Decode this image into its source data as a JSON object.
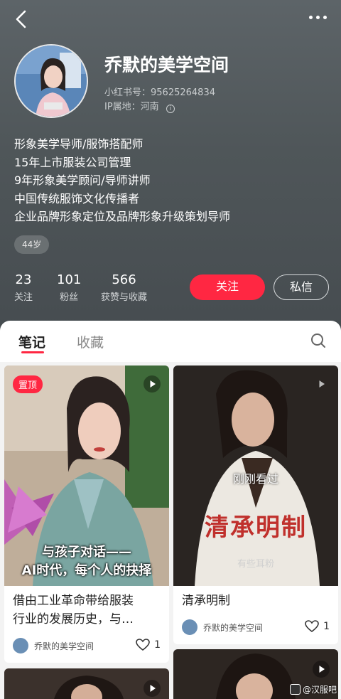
{
  "profile": {
    "nickname": "乔默的美学空间",
    "xhs_id": "小红书号：95625264834",
    "ip_location": "IP属地：河南",
    "bio": [
      "形象美学导师/服饰搭配师",
      "15年上市服装公司管理",
      "9年形象美学顾问/导师讲师",
      "中国传统服饰文化传播者",
      "企业品牌形象定位及品牌形象升级策划导师"
    ],
    "age_tag": "44岁",
    "stats": [
      {
        "num": "23",
        "label": "关注"
      },
      {
        "num": "101",
        "label": "粉丝"
      },
      {
        "num": "566",
        "label": "获赞与收藏"
      }
    ],
    "follow_label": "关注",
    "message_label": "私信"
  },
  "tabs": [
    {
      "label": "笔记",
      "active": true
    },
    {
      "label": "收藏",
      "active": false
    }
  ],
  "cards": [
    {
      "pin_label": "置顶",
      "overlay_line1": "与孩子对话——",
      "overlay_line2": "AI时代，每个人的抉择",
      "title_line1": "借由工业革命带给服装",
      "title_line2": "行业的发展历史，与…",
      "author": "乔默的美学空间",
      "likes": "1"
    },
    {
      "overlay_seen": "刚刚看过",
      "overlay_big": "清承明制",
      "overlay_small": "有些耳粉",
      "title": "清承明制",
      "author": "乔默的美学空间",
      "likes": "1"
    }
  ],
  "watermark": "@汉服吧",
  "colors": {
    "accent": "#ff2742",
    "header_bg": "#50575a"
  },
  "icons": [
    "back-icon",
    "more-icon",
    "info-icon",
    "search-icon",
    "play-icon",
    "heart-icon"
  ]
}
